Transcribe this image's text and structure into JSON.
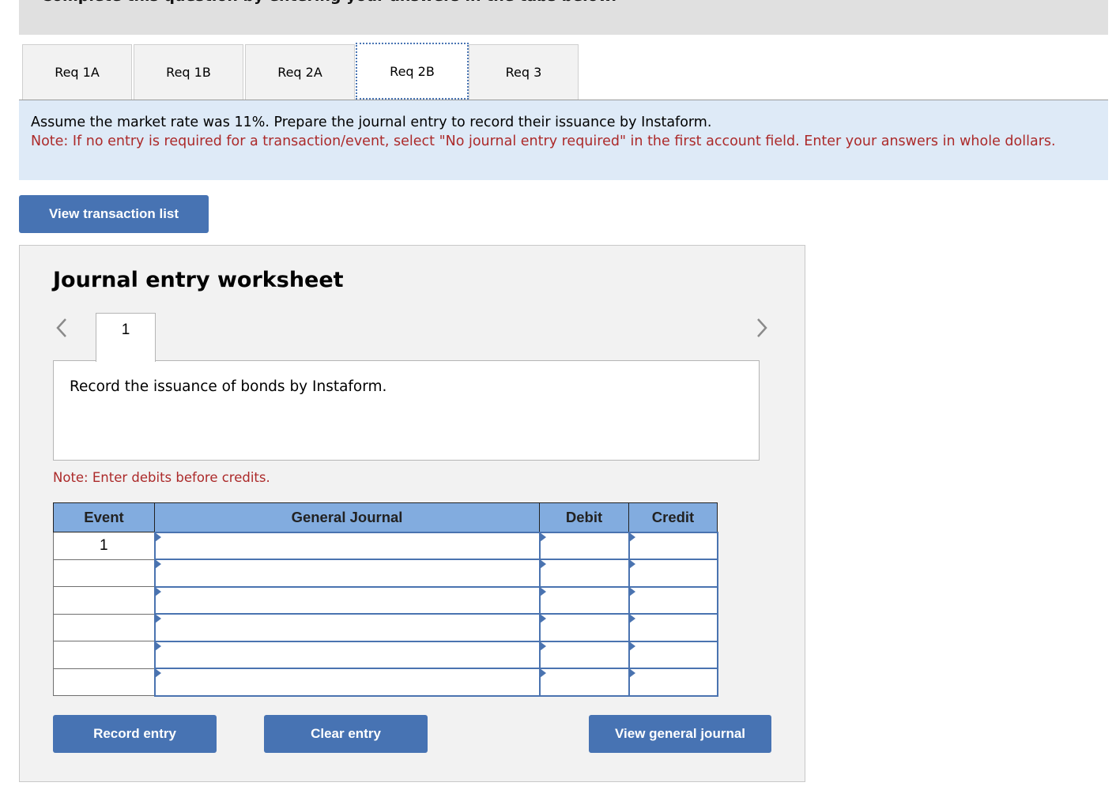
{
  "header": {
    "text": "Complete this question by entering your answers in the tabs below."
  },
  "tabs": [
    {
      "label": "Req 1A",
      "active": false
    },
    {
      "label": "Req 1B",
      "active": false
    },
    {
      "label": "Req 2A",
      "active": false
    },
    {
      "label": "Req 2B",
      "active": true
    },
    {
      "label": "Req 3",
      "active": false
    }
  ],
  "instructions": {
    "main": "Assume the market rate was 11%. Prepare the journal entry to record their issuance by Instaform.",
    "note": "Note: If no entry is required for a transaction/event, select \"No journal entry required\" in the first account field. Enter your answers in whole dollars."
  },
  "view_transaction_list_label": "View transaction list",
  "worksheet": {
    "title": "Journal entry worksheet",
    "prev_icon": "chevron-left-icon",
    "next_icon": "chevron-right-icon",
    "entry_tab_label": "1",
    "description": "Record the issuance of bonds by Instaform.",
    "debit_note": "Note: Enter debits before credits.",
    "table": {
      "headers": [
        "Event",
        "General Journal",
        "Debit",
        "Credit"
      ],
      "rows": [
        {
          "event": "1",
          "account": "",
          "debit": "",
          "credit": ""
        },
        {
          "event": "",
          "account": "",
          "debit": "",
          "credit": ""
        },
        {
          "event": "",
          "account": "",
          "debit": "",
          "credit": ""
        },
        {
          "event": "",
          "account": "",
          "debit": "",
          "credit": ""
        },
        {
          "event": "",
          "account": "",
          "debit": "",
          "credit": ""
        },
        {
          "event": "",
          "account": "",
          "debit": "",
          "credit": ""
        }
      ]
    },
    "buttons": {
      "record": "Record entry",
      "clear": "Clear entry",
      "view_general_journal": "View general journal"
    }
  },
  "colors": {
    "button_blue": "#4773b3",
    "header_blue": "#82acdf",
    "note_red": "#ac2a2a",
    "instructions_bg": "#deeaf7"
  }
}
